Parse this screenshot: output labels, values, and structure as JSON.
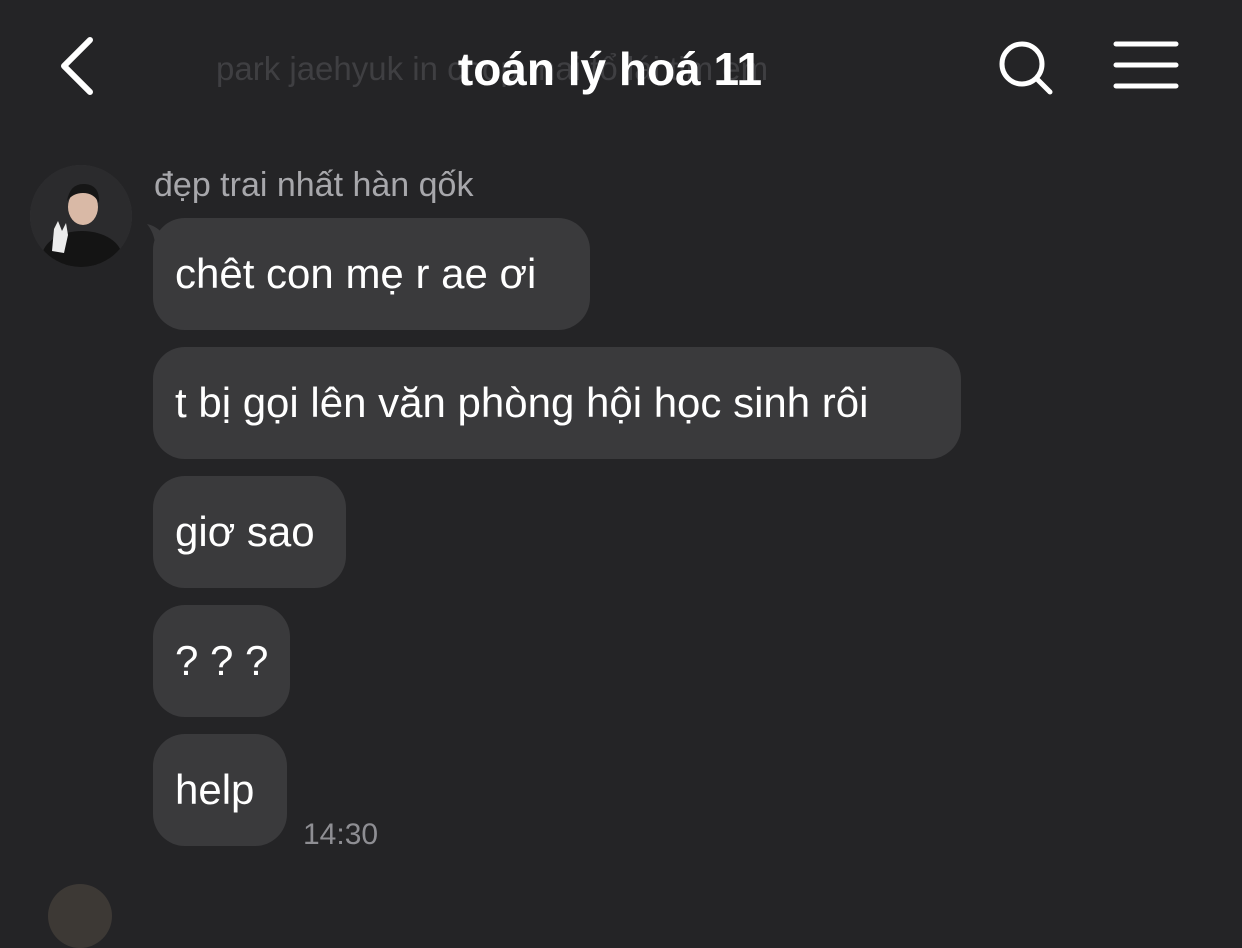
{
  "header": {
    "title": "toán lý hoá 11",
    "subtitle": "park jaehyuk in chop mai tổ lái tim em",
    "back_icon": "chevron-left-icon",
    "search_icon": "search-icon",
    "menu_icon": "hamburger-menu-icon"
  },
  "chat": {
    "sender_name": "đẹp trai nhất hàn qốk",
    "messages": [
      {
        "text": "chêt con mẹ r ae ơi"
      },
      {
        "text": "t bị gọi lên văn phòng hội học sinh rôi"
      },
      {
        "text": "giơ sao"
      },
      {
        "text": "? ? ?"
      },
      {
        "text": "help"
      }
    ],
    "last_timestamp": "14:30"
  },
  "colors": {
    "background": "#242426",
    "bubble": "#3a3a3c",
    "text": "#ffffff",
    "secondary_text": "#a7a7ab"
  }
}
